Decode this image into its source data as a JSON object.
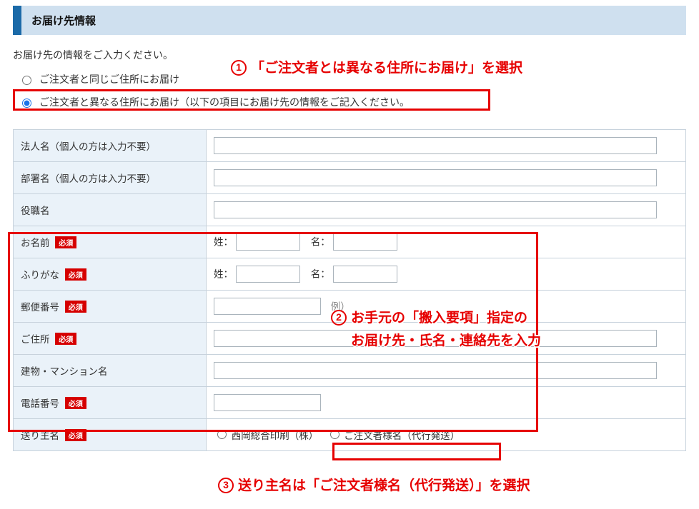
{
  "section_title": "お届け先情報",
  "intro": "お届け先の情報をご入力ください。",
  "radios": {
    "same": "ご注文者と同じご住所にお届け",
    "different": "ご注文者と異なる住所にお届け（以下の項目にお届け先の情報をご記入ください。"
  },
  "labels": {
    "corp": "法人名（個人の方は入力不要）",
    "dept": "部署名（個人の方は入力不要）",
    "title": "役職名",
    "name": "お名前",
    "kana": "ふりがな",
    "zip": "郵便番号",
    "address": "ご住所",
    "building": "建物・マンション名",
    "phone": "電話番号",
    "sender": "送り主名"
  },
  "required_badge": "必須",
  "name_prefix_sei": "姓：",
  "name_prefix_mei": "名：",
  "zip_example": "例）",
  "sender_options": {
    "nishioka": "西岡総合印刷（株）",
    "customer": "ご注文者様名（代行発送）"
  },
  "annotations": {
    "a1": "「ご注文者とは異なる住所にお届け」を選択",
    "a2_line1": "お手元の「搬入要項」指定の",
    "a2_line2": "お届け先・氏名・連絡先を入力",
    "a3": "送り主名は「ご注文者様名（代行発送）」を選択"
  }
}
